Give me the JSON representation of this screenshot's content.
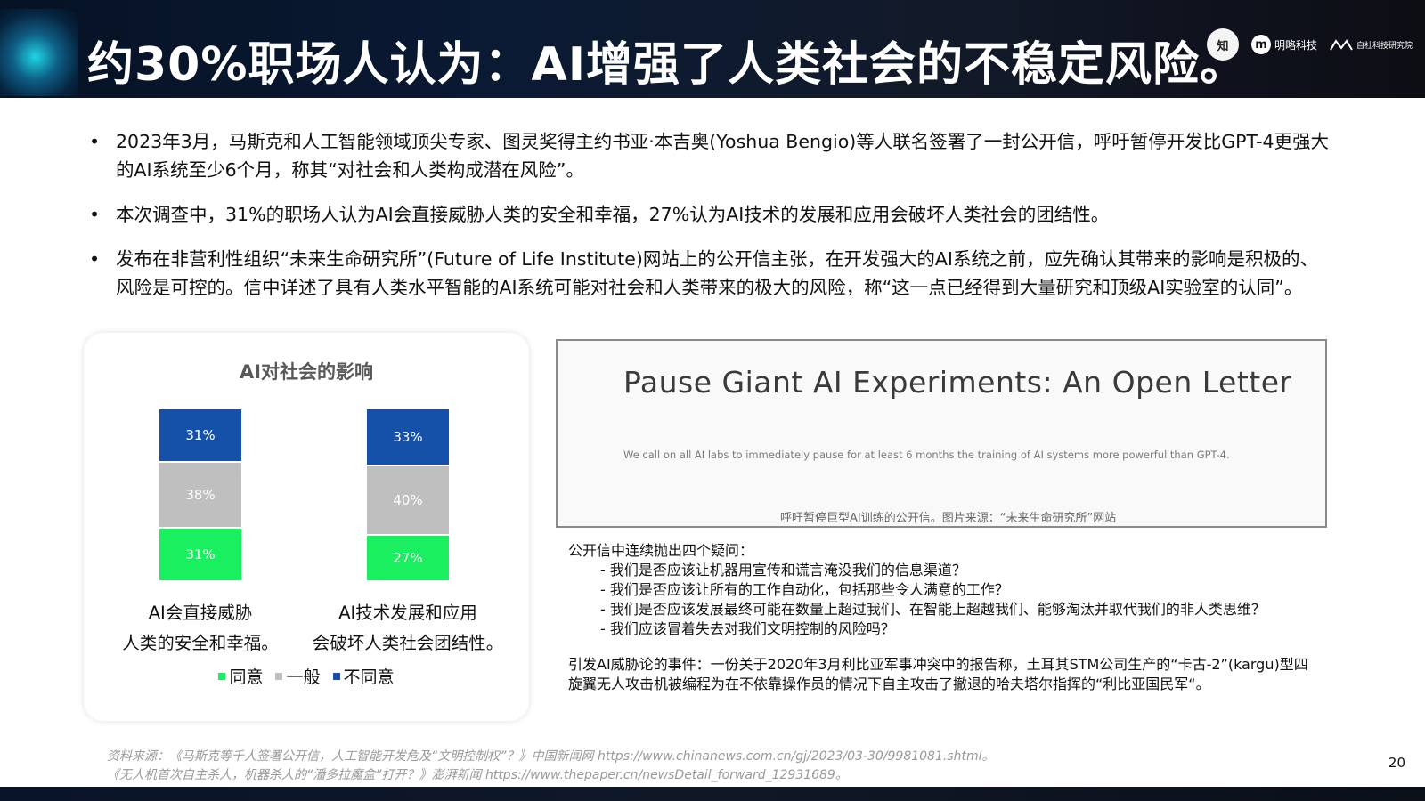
{
  "header": {
    "title": "约30%职场人认为：AI增强了人类社会的不稳定风险。",
    "logos": [
      "知识人文",
      "明略科技",
      "自社科技研究院"
    ],
    "colors": {
      "background": "#0a1a33",
      "title": "#ffffff"
    }
  },
  "bullets": [
    "2023年3月，马斯克和人工智能领域顶尖专家、图灵奖得主约书亚·本吉奥(Yoshua Bengio)等人联名签署了一封公开信，呼吁暂停开发比GPT-4更强大的AI系统至少6个月，称其“对社会和人类构成潜在风险”。",
    "本次调查中，31%的职场人认为AI会直接威胁人类的安全和幸福，27%认为AI技术的发展和应用会破坏人类社会的团结性。",
    "发布在非营利性组织“未来生命研究所”(Future of Life Institute)网站上的公开信主张，在开发强大的AI系统之前，应先确认其带来的影响是积极的、风险是可控的。信中详述了具有人类水平智能的AI系统可能对社会和人类带来的极大的风险，称“这一点已经得到大量研究和顶级AI实验室的认同”。"
  ],
  "chart_data": {
    "type": "bar",
    "stacked": true,
    "title": "AI对社会的影响",
    "categories": [
      "AI会直接威胁人类的安全和幸福。",
      "AI技术发展和应用会破坏人类社会团结性。"
    ],
    "category_lines": [
      [
        "AI会直接威胁",
        "人类的安全和幸福。"
      ],
      [
        "AI技术发展和应用",
        "会破坏人类社会团结性。"
      ]
    ],
    "series": [
      {
        "name": "同意",
        "values": [
          31,
          27
        ],
        "labels": [
          "31%",
          "27%"
        ],
        "color": "#19ef5f"
      },
      {
        "name": "一般",
        "values": [
          38,
          40
        ],
        "labels": [
          "38%",
          "40%"
        ],
        "color": "#bfbfbf"
      },
      {
        "name": "不同意",
        "values": [
          31,
          33
        ],
        "labels": [
          "31%",
          "33%"
        ],
        "color": "#1551a9"
      }
    ],
    "legend_position": "bottom",
    "grid": false
  },
  "letter": {
    "title": "Pause Giant AI Experiments: An Open Letter",
    "body": "We call on all AI labs to immediately pause for at least 6 months the training of AI systems more powerful than GPT-4.",
    "caption": "呼吁暂停巨型AI训练的公开信。图片来源：“未来生命研究所”网站"
  },
  "right_text": {
    "intro": "公开信中连续抛出四个疑问：",
    "questions": [
      "- 我们是否应该让机器用宣传和谎言淹没我们的信息渠道？",
      "- 我们是否应该让所有的工作自动化，包括那些令人满意的工作？",
      "- 我们是否应该发展最终可能在数量上超过我们、在智能上超越我们、能够淘汰并取代我们的非人类思维？",
      "- 我们应该冒着失去对我们文明控制的风险吗？"
    ],
    "event": "引发AI威胁论的事件：一份关于2020年3月利比亚军事冲突中的报告称，土耳其STM公司生产的“卡古-2”(kargu)型四旋翼无人攻击机被编程为在不依靠操作员的情况下自主攻击了撤退的哈夫塔尔指挥的“利比亚国民军“。"
  },
  "sources": {
    "line1": "资料来源：《马斯克等千人签署公开信，人工智能开发危及“文明控制权”？》中国新闻网 https://www.chinanews.com.cn/gj/2023/03-30/9981081.shtml。",
    "line2": "《无人机首次自主杀人，机器杀人的“潘多拉魔盒”打开？》澎湃新闻 https://www.thepaper.cn/newsDetail_forward_12931689。"
  },
  "page_number": "20"
}
